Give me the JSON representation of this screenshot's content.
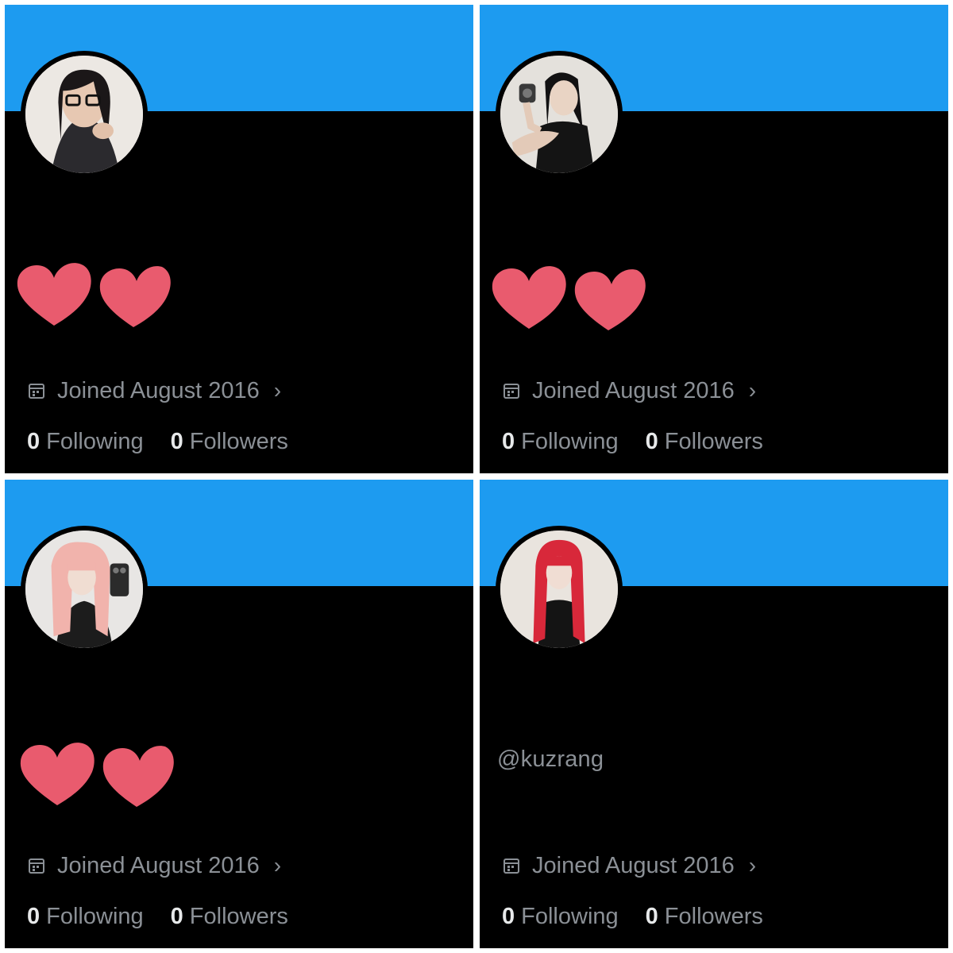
{
  "colors": {
    "banner": "#1d9bf0",
    "background": "#000000",
    "muted_text": "#8b9096",
    "count_text": "#e7e9ea",
    "heart": "#e95b6e"
  },
  "profiles": [
    {
      "handle": "",
      "handle_covered_by_sticker": true,
      "joined": "Joined August 2016",
      "following_count": "0",
      "following_label": "Following",
      "followers_count": "0",
      "followers_label": "Followers"
    },
    {
      "handle": "",
      "handle_covered_by_sticker": true,
      "joined": "Joined August 2016",
      "following_count": "0",
      "following_label": "Following",
      "followers_count": "0",
      "followers_label": "Followers"
    },
    {
      "handle": "",
      "handle_covered_by_sticker": true,
      "joined": "Joined August 2016",
      "following_count": "0",
      "following_label": "Following",
      "followers_count": "0",
      "followers_label": "Followers"
    },
    {
      "handle": "@kuzrang",
      "handle_covered_by_sticker": false,
      "joined": "Joined August 2016",
      "following_count": "0",
      "following_label": "Following",
      "followers_count": "0",
      "followers_label": "Followers"
    }
  ],
  "icons": {
    "calendar": "calendar-icon",
    "chevron": "chevron-right-icon",
    "sticker": "two-hearts-sticker"
  },
  "chevron_glyph": "›"
}
